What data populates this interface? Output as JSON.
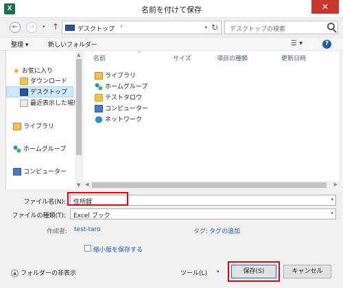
{
  "window": {
    "title": "名前を付けて保存",
    "app_icon_letter": "X",
    "close_glyph": "✕"
  },
  "nav": {
    "back_glyph": "←",
    "forward_glyph": "→",
    "recent_glyph": "▾",
    "up_glyph": "↑",
    "address_path": "デスクトップ",
    "address_chevron": "›",
    "address_dropdown_glyph": "▾",
    "refresh_glyph": "↻",
    "search_placeholder": "デスクトップの検索"
  },
  "toolbar": {
    "organize_label": "整理 ▾",
    "new_folder_label": "新しいフォルダー",
    "view_label": "☰ ▾",
    "help_label": "?"
  },
  "nav_pane": {
    "items": [
      {
        "label": "お気に入り",
        "icon": "star-icon"
      },
      {
        "label": "ダウンロード",
        "icon": "downloads-folder-icon"
      },
      {
        "label": "デスクトップ",
        "icon": "desktop-icon"
      },
      {
        "label": "最近表示した場所",
        "icon": "recent-places-icon"
      },
      {
        "label": "ライブラリ",
        "icon": "libraries-icon"
      },
      {
        "label": "ホームグループ",
        "icon": "homegroup-icon"
      },
      {
        "label": "コンピューター",
        "icon": "computer-icon"
      }
    ]
  },
  "file_list": {
    "columns": [
      "名前",
      "サイズ",
      "項目の種類",
      "更新日時"
    ],
    "sort_glyph": "^",
    "rows": [
      {
        "name": "ライブラリ",
        "icon": "libraries-icon"
      },
      {
        "name": "ホームグループ",
        "icon": "homegroup-icon"
      },
      {
        "name": "テストタロウ",
        "icon": "user-folder-icon"
      },
      {
        "name": "コンピューター",
        "icon": "computer-icon"
      },
      {
        "name": "ネットワーク",
        "icon": "network-icon"
      }
    ]
  },
  "form": {
    "filename_label": "ファイル名(N):",
    "filename_value": "住所録",
    "filetype_label": "ファイルの種類(T):",
    "filetype_value": "Excel ブック",
    "dropdown_glyph": "▾"
  },
  "meta": {
    "author_label": "作成者:",
    "author_value": "test-taro",
    "tags_label": "タグ:",
    "tags_value": "タグの追加",
    "thumbnail_label": "縮小版を保存する"
  },
  "bottom": {
    "hide_folders_label": "フォルダーの非表示",
    "hide_folders_glyph": "▲",
    "tools_label": "ツール(L)",
    "tools_dropdown_glyph": "▾",
    "save_label": "保存(S)",
    "cancel_label": "キャンセル"
  },
  "colors": {
    "highlight_red": "#e60012",
    "link_blue": "#1e5aa8",
    "selection_blue": "#cde8ff",
    "close_red": "#c7372f"
  }
}
